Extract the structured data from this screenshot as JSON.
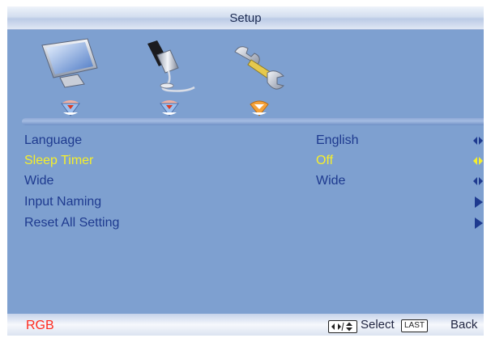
{
  "header": {
    "title": "Setup"
  },
  "tabs": [
    {
      "name": "display",
      "icon": "monitor-icon",
      "active": false
    },
    {
      "name": "sound",
      "icon": "microphone-icon",
      "active": false
    },
    {
      "name": "setup",
      "icon": "wrench-icon",
      "active": true
    }
  ],
  "menu": {
    "items": [
      {
        "label": "Language",
        "value": "English",
        "control": "left-right"
      },
      {
        "label": "Sleep Timer",
        "value": "Off",
        "control": "left-right",
        "selected": true
      },
      {
        "label": "Wide",
        "value": "Wide",
        "control": "left-right"
      },
      {
        "label": "Input Naming",
        "value": "",
        "control": "enter"
      },
      {
        "label": "Reset All Setting",
        "value": "",
        "control": "enter"
      }
    ]
  },
  "footer": {
    "source": "RGB",
    "select_label": "Select",
    "back_key": "LAST",
    "back_label": "Back"
  },
  "colors": {
    "panel": "#7ea0d0",
    "item_text": "#1e3a8f",
    "selected_text": "#f6ef2a",
    "source_text": "#ff2a1e"
  }
}
